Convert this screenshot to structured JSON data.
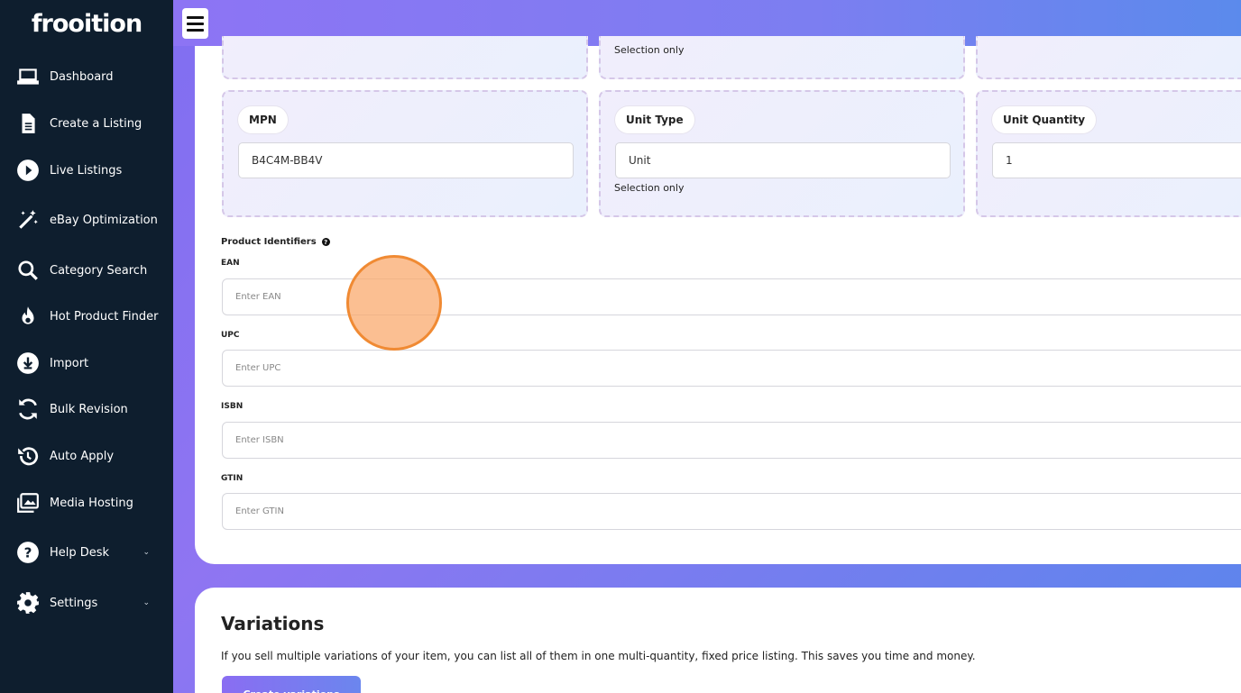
{
  "app": {
    "logo": "frooition"
  },
  "sidebar": {
    "items": [
      {
        "label": "Dashboard",
        "icon": "laptop-icon"
      },
      {
        "label": "Create a Listing",
        "icon": "document-icon"
      },
      {
        "label": "Live Listings",
        "icon": "play-circle-icon"
      },
      {
        "label": "eBay Optimization",
        "icon": "magic-wand-icon"
      },
      {
        "label": "Category Search",
        "icon": "search-icon"
      },
      {
        "label": "Hot Product Finder",
        "icon": "fire-icon"
      },
      {
        "label": "Import",
        "icon": "download-circle-icon"
      },
      {
        "label": "Bulk Revision",
        "icon": "sync-icon"
      },
      {
        "label": "Auto Apply",
        "icon": "history-icon"
      },
      {
        "label": "Media Hosting",
        "icon": "images-icon"
      },
      {
        "label": "Help Desk",
        "icon": "question-circle-icon"
      },
      {
        "label": "Settings",
        "icon": "gear-icon"
      }
    ]
  },
  "specifics": {
    "top_row_helper": "Selection only",
    "mpn": {
      "label": "MPN",
      "value": "B4C4M-BB4V"
    },
    "unit_type": {
      "label": "Unit Type",
      "value": "Unit",
      "helper": "Selection only"
    },
    "unit_quantity": {
      "label": "Unit Quantity",
      "value": "1"
    }
  },
  "identifiers": {
    "title": "Product Identifiers",
    "ean": {
      "label": "EAN",
      "placeholder": "Enter EAN"
    },
    "upc": {
      "label": "UPC",
      "placeholder": "Enter UPC"
    },
    "isbn": {
      "label": "ISBN",
      "placeholder": "Enter ISBN"
    },
    "gtin": {
      "label": "GTIN",
      "placeholder": "Enter GTIN"
    }
  },
  "variations": {
    "title": "Variations",
    "description": "If you sell multiple variations of your item, you can list all of them in one multi-quantity, fixed price listing. This saves you time and money.",
    "button": "Create variations"
  }
}
